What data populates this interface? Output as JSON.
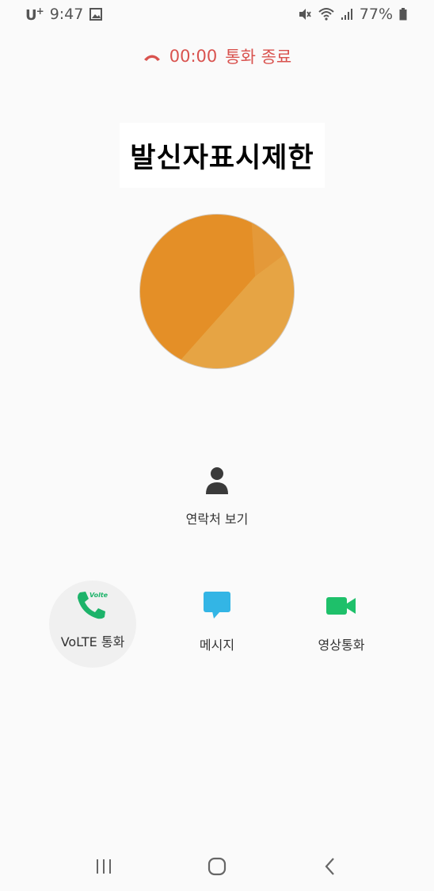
{
  "status_bar": {
    "carrier": "U",
    "carrier_sup": "+",
    "time": "9:47",
    "battery": "77%"
  },
  "call": {
    "duration": "00:00",
    "status_label": "통화 종료"
  },
  "caller": {
    "name": "발신자표시제한"
  },
  "contact": {
    "view_label": "연락처 보기"
  },
  "actions": {
    "volte_label": "VoLTE 통화",
    "volte_badge": "Volte",
    "message_label": "메시지",
    "video_label": "영상통화"
  },
  "colors": {
    "end_red": "#d9534f",
    "volte_green": "#1db36a",
    "message_blue": "#33b5e5",
    "video_green": "#1ec06a",
    "avatar_orange": "#e8a040"
  }
}
